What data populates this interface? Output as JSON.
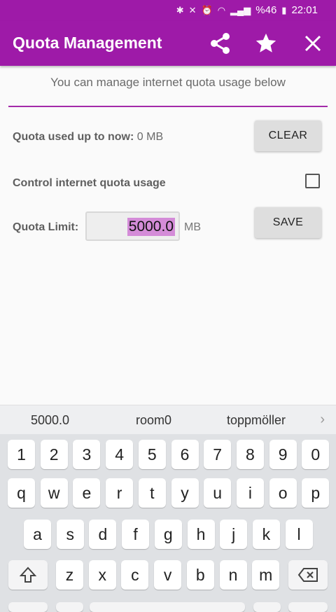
{
  "status_bar": {
    "battery": "%46",
    "time": "22:01"
  },
  "app_bar": {
    "title": "Quota Management",
    "share_icon": "share-icon",
    "favorite_icon": "star-icon",
    "close_icon": "close-icon"
  },
  "subtitle": "You can manage internet quota usage below",
  "quota_used": {
    "label": "Quota used up to now:",
    "value": "0 MB",
    "clear_label": "CLEAR"
  },
  "control": {
    "label": "Control internet quota usage",
    "checked": false
  },
  "limit": {
    "label": "Quota Limit:",
    "value": "5000.0",
    "unit": "MB",
    "save_label": "SAVE"
  },
  "suggestions": [
    "5000.0",
    "room0",
    "toppmöller"
  ],
  "keyboard": {
    "row1": [
      "1",
      "2",
      "3",
      "4",
      "5",
      "6",
      "7",
      "8",
      "9",
      "0"
    ],
    "row2": [
      "q",
      "w",
      "e",
      "r",
      "t",
      "y",
      "u",
      "i",
      "o",
      "p"
    ],
    "row3": [
      "a",
      "s",
      "d",
      "f",
      "g",
      "h",
      "j",
      "k",
      "l"
    ],
    "row4": [
      "z",
      "x",
      "c",
      "v",
      "b",
      "n",
      "m"
    ]
  }
}
